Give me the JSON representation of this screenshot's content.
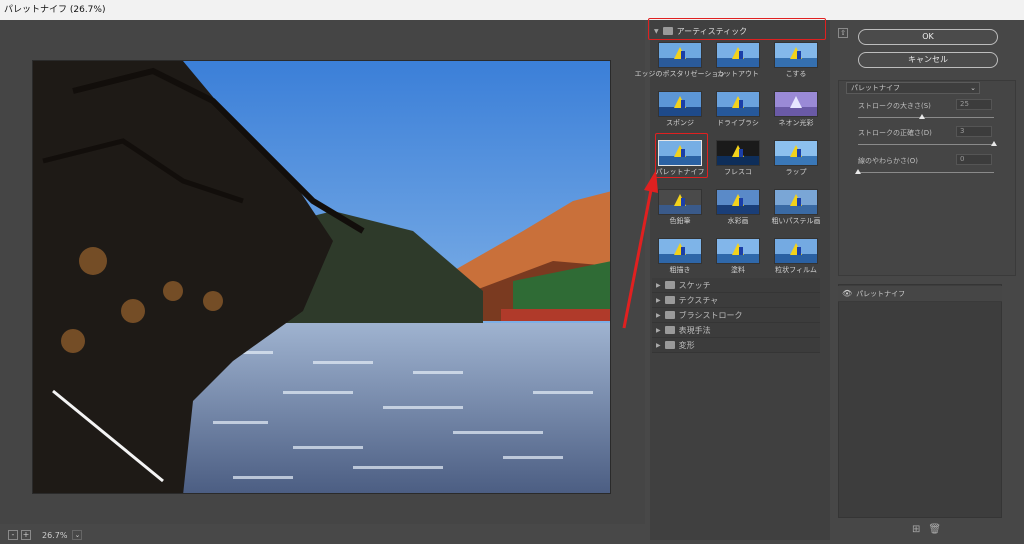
{
  "window": {
    "title": "パレットナイフ (26.7%)"
  },
  "preview": {
    "zoom": "26.7%",
    "zoom_minus": "-",
    "zoom_plus": "+",
    "zoom_caret": "⌄"
  },
  "gallery": {
    "category": "アーティスティック",
    "thumbnails": [
      {
        "label": "エッジのポスタリゼーション"
      },
      {
        "label": "カットアウト"
      },
      {
        "label": "こする"
      },
      {
        "label": "スポンジ"
      },
      {
        "label": "ドライブラシ"
      },
      {
        "label": "ネオン光彩"
      },
      {
        "label": "パレットナイフ"
      },
      {
        "label": "フレスコ"
      },
      {
        "label": "ラップ"
      },
      {
        "label": "色鉛筆"
      },
      {
        "label": "水彩画"
      },
      {
        "label": "粗いパステル画"
      },
      {
        "label": "粗描き"
      },
      {
        "label": "塗料"
      },
      {
        "label": "粒状フィルム"
      }
    ],
    "other_categories": [
      "スケッチ",
      "テクスチャ",
      "ブラシストローク",
      "表現手法",
      "変形"
    ]
  },
  "buttons": {
    "ok": "OK",
    "cancel": "キャンセル"
  },
  "settings": {
    "filter": "パレットナイフ",
    "params": [
      {
        "label": "ストロークの大きさ(S)",
        "value": "25",
        "level": 0.47
      },
      {
        "label": "ストロークの正確さ(D)",
        "value": "3",
        "level": 1.0
      },
      {
        "label": "線のやわらかさ(O)",
        "value": "0",
        "level": 0.0
      }
    ]
  },
  "layer": {
    "name": "パレットナイフ"
  },
  "icons": {
    "eye": "eye-icon",
    "new_layer": "new-effect-layer-icon",
    "delete": "trash-icon"
  },
  "colors": {
    "highlight": "#e02020",
    "dialog_bg": "#484848"
  }
}
